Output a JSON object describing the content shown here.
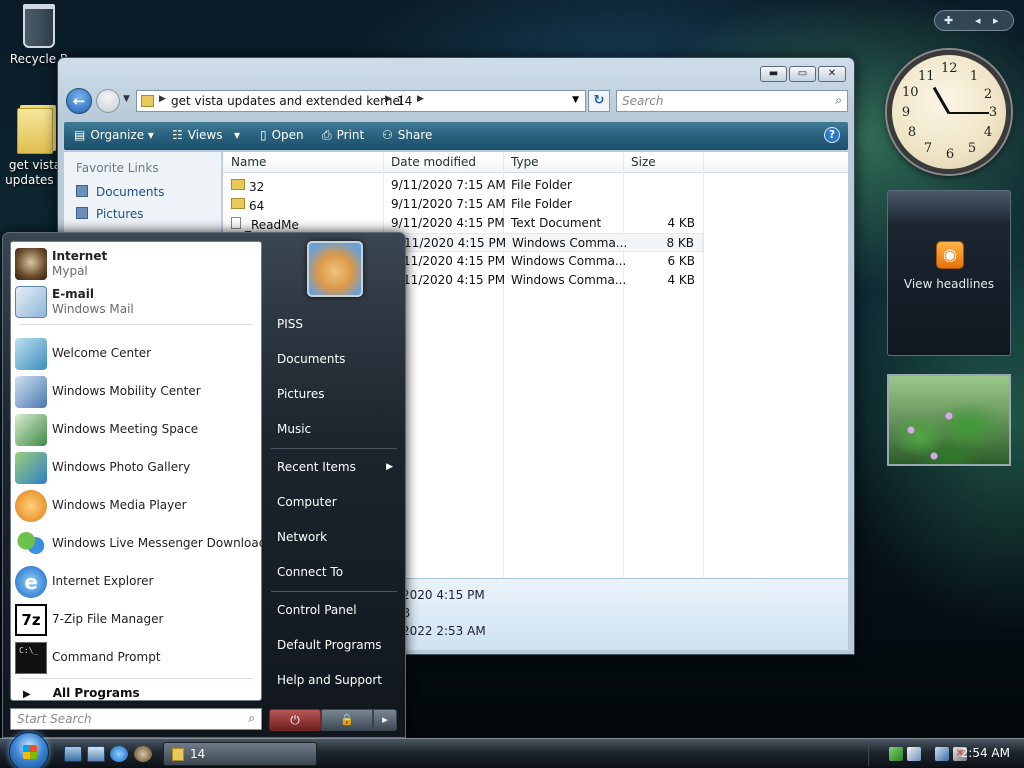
{
  "desktop": {
    "recycle_bin": "Recycle B",
    "folder_line1": "get vista",
    "folder_line2": "updates a"
  },
  "explorer": {
    "breadcrumb": [
      "get vista updates and extended kernel",
      "14"
    ],
    "search_placeholder": "Search",
    "toolbar": {
      "organize": "Organize",
      "views": "Views",
      "open": "Open",
      "print": "Print",
      "share": "Share"
    },
    "sidebar": {
      "header": "Favorite Links",
      "links": [
        "Documents",
        "Pictures"
      ]
    },
    "columns": [
      "Name",
      "Date modified",
      "Type",
      "Size"
    ],
    "files": [
      {
        "name": "32",
        "date": "9/11/2020 7:15 AM",
        "type": "File Folder",
        "size": ""
      },
      {
        "name": "64",
        "date": "9/11/2020 7:15 AM",
        "type": "File Folder",
        "size": ""
      },
      {
        "name": "_ReadMe",
        "date": "9/11/2020 4:15 PM",
        "type": "Text Document",
        "size": "4 KB"
      },
      {
        "name": "",
        "date": "/11/2020 4:15 PM",
        "type": "Windows Comma...",
        "size": "8 KB"
      },
      {
        "name": "",
        "date": "/11/2020 4:15 PM",
        "type": "Windows Comma...",
        "size": "6 KB"
      },
      {
        "name": "",
        "date": "/11/2020 4:15 PM",
        "type": "Windows Comma...",
        "size": "4 KB"
      }
    ],
    "details": [
      "2020 4:15 PM",
      "B",
      "2022 2:53 AM"
    ]
  },
  "gadgets": {
    "feed_label": "View headlines",
    "clock_numbers": [
      "12",
      "1",
      "2",
      "3",
      "4",
      "5",
      "6",
      "7",
      "8",
      "9",
      "10",
      "11"
    ]
  },
  "start_menu": {
    "pinned": [
      {
        "title": "Internet",
        "subtitle": "Mypal"
      },
      {
        "title": "E-mail",
        "subtitle": "Windows Mail"
      }
    ],
    "recent": [
      "Welcome Center",
      "Windows Mobility Center",
      "Windows Meeting Space",
      "Windows Photo Gallery",
      "Windows Media Player",
      "Windows Live Messenger Download",
      "Internet Explorer",
      "7-Zip File Manager",
      "Command Prompt"
    ],
    "all_programs": "All Programs",
    "search_placeholder": "Start Search",
    "right_links": {
      "user": "PISS",
      "documents": "Documents",
      "pictures": "Pictures",
      "music": "Music",
      "recent_items": "Recent Items",
      "computer": "Computer",
      "network": "Network",
      "connect_to": "Connect To",
      "control_panel": "Control Panel",
      "default_programs": "Default Programs",
      "help": "Help and Support"
    }
  },
  "taskbar": {
    "task_label": "14",
    "time": "2:54 AM"
  }
}
